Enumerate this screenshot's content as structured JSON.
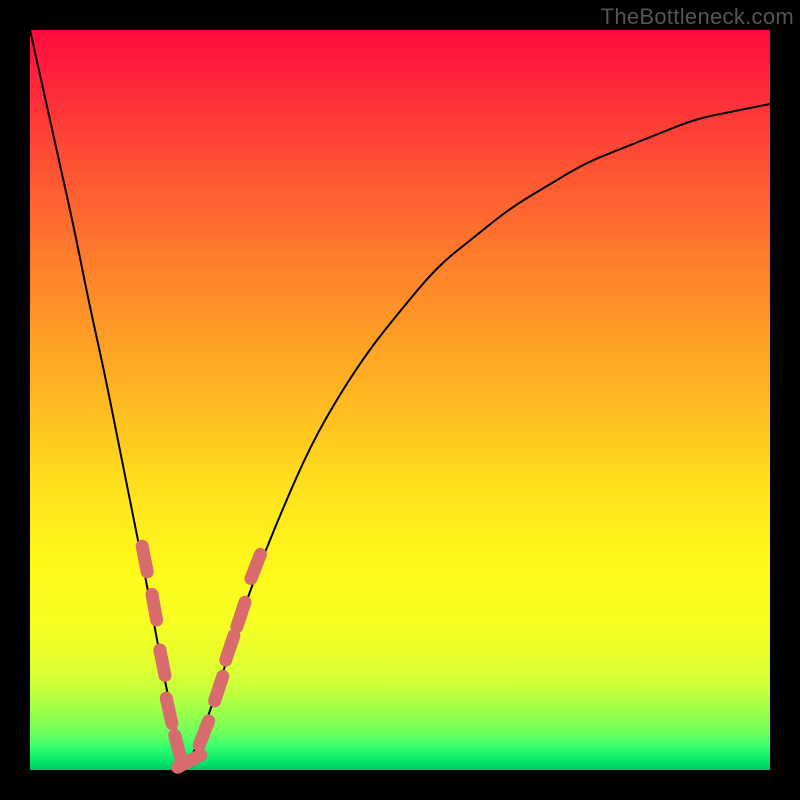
{
  "watermark": "TheBottleneck.com",
  "colors": {
    "background": "#000000",
    "curve": "#000000",
    "dash": "#d86b6c",
    "gradient_top": "#ff0b3e",
    "gradient_bottom": "#00c860"
  },
  "chart_data": {
    "type": "line",
    "title": "",
    "xlabel": "",
    "ylabel": "",
    "xlim": [
      0,
      100
    ],
    "ylim": [
      0,
      100
    ],
    "grid": false,
    "legend": null,
    "note": "Values estimated from pixel positions; y = 0 at bottom (green), y = 100 at top (red). Curve reaches minimum (≈0) near x ≈ 21.",
    "series": [
      {
        "name": "bottleneck-curve",
        "x": [
          0,
          2,
          4,
          6,
          8,
          10,
          12,
          14,
          16,
          18,
          20,
          21,
          22,
          24,
          26,
          28,
          30,
          34,
          38,
          42,
          46,
          50,
          55,
          60,
          65,
          70,
          75,
          80,
          85,
          90,
          95,
          100
        ],
        "y": [
          100,
          91,
          82,
          73,
          63,
          54,
          44,
          34,
          24,
          13,
          4,
          1,
          2,
          7,
          13,
          19,
          25,
          35,
          44,
          51,
          57,
          62,
          68,
          72,
          76,
          79,
          82,
          84,
          86,
          88,
          89,
          90
        ]
      }
    ],
    "markers": {
      "name": "highlighted-dashes",
      "description": "Pink rounded dash segments overlaid on the lower portion of the curve",
      "segments": [
        {
          "x": 15.5,
          "y": 28.5
        },
        {
          "x": 16.8,
          "y": 22.0
        },
        {
          "x": 17.9,
          "y": 14.5
        },
        {
          "x": 18.8,
          "y": 8.0
        },
        {
          "x": 20.0,
          "y": 3.0
        },
        {
          "x": 21.5,
          "y": 1.2
        },
        {
          "x": 23.5,
          "y": 5.0
        },
        {
          "x": 25.5,
          "y": 11.0
        },
        {
          "x": 27.0,
          "y": 16.5
        },
        {
          "x": 28.5,
          "y": 21.0
        },
        {
          "x": 30.5,
          "y": 27.5
        }
      ]
    }
  }
}
